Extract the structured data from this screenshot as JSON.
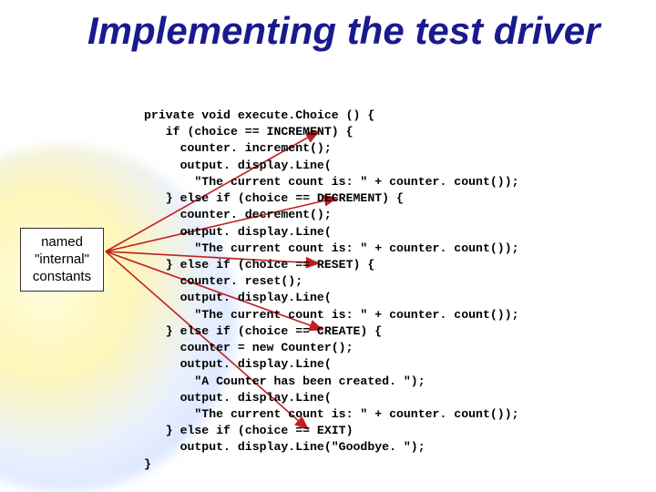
{
  "title": "Implementing the test driver",
  "callout": "named \"internal\" constants",
  "code_lines": [
    "private void execute.Choice () {",
    "   if (choice == INCREMENT) {",
    "     counter. increment();",
    "     output. display.Line(",
    "       \"The current count is: \" + counter. count());",
    "   } else if (choice == DECREMENT) {",
    "     counter. decrement();",
    "     output. display.Line(",
    "       \"The current count is: \" + counter. count());",
    "   } else if (choice == RESET) {",
    "     counter. reset();",
    "     output. display.Line(",
    "       \"The current count is: \" + counter. count());",
    "   } else if (choice == CREATE) {",
    "     counter = new Counter();",
    "     output. display.Line(",
    "       \"A Counter has been created. \");",
    "     output. display.Line(",
    "       \"The current count is: \" + counter. count());",
    "   } else if (choice == EXIT)",
    "     output. display.Line(\"Goodbye. \");",
    "}"
  ],
  "arrow_targets": [
    "INCREMENT",
    "DECREMENT",
    "RESET",
    "CREATE",
    "EXIT"
  ],
  "colors": {
    "title": "#1a1a8f",
    "arrow": "#c02020"
  }
}
